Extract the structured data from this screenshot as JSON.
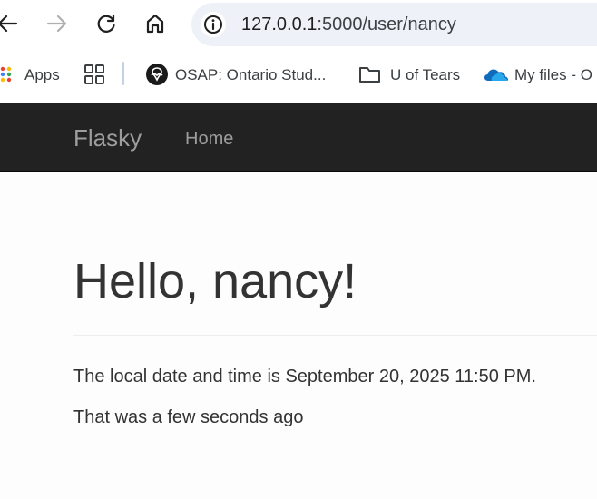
{
  "browser": {
    "url_host": "127.0.0.1",
    "url_rest": ":5000/user/nancy"
  },
  "bookmarks": [
    {
      "label": "Apps"
    },
    {
      "label": "OSAP: Ontario Stud..."
    },
    {
      "label": "U of Tears"
    },
    {
      "label": "My files - O"
    }
  ],
  "navbar": {
    "brand": "Flasky",
    "home": "Home"
  },
  "page": {
    "heading": "Hello, nancy!",
    "datetime_text": "The local date and time is September 20, 2025 11:50 PM.",
    "relative_text": "That was a few seconds ago"
  },
  "colors": {
    "navbar_bg": "#222222",
    "navbar_text": "#9d9d9d",
    "omnibox_bg": "#eef2f8",
    "onedrive_blue": "#0f6cbd"
  }
}
